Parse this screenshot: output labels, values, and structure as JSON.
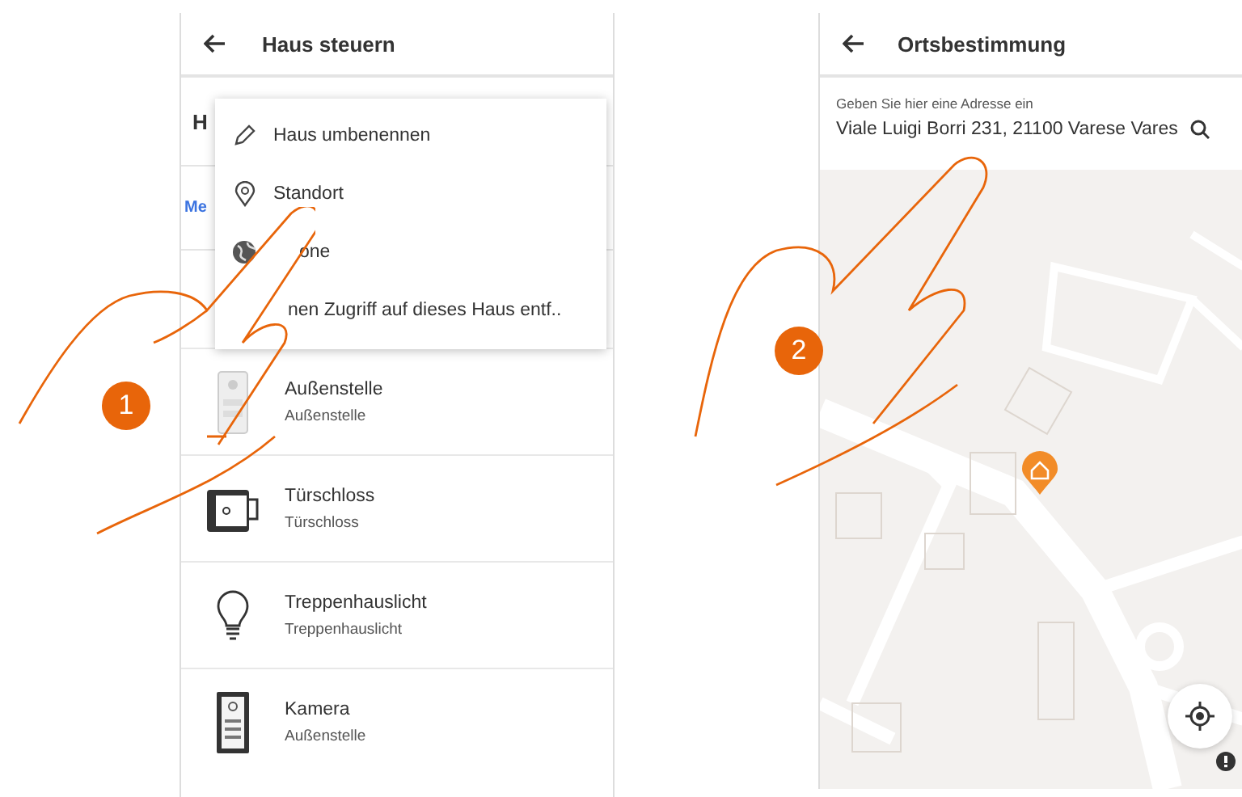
{
  "left_screen": {
    "title": "Haus steuern",
    "partial_row_text": "H",
    "partial_link": "Me",
    "menu": [
      {
        "kind": "rename",
        "label": "Haus umbenennen"
      },
      {
        "kind": "location",
        "label": "Standort"
      },
      {
        "kind": "zone",
        "label": "one"
      },
      {
        "kind": "plain",
        "label": "nen Zugriff auf dieses Haus entf.."
      }
    ],
    "devices": [
      {
        "kind": "outdoor",
        "name": "Außenstelle",
        "subtitle": "Außenstelle"
      },
      {
        "kind": "lock",
        "name": "Türschloss",
        "subtitle": "Türschloss"
      },
      {
        "kind": "light",
        "name": "Treppenhauslicht",
        "subtitle": "Treppenhauslicht"
      },
      {
        "kind": "camera",
        "name": "Kamera",
        "subtitle": "Außenstelle"
      }
    ]
  },
  "right_screen": {
    "title": "Ortsbestimmung",
    "address_field": {
      "label": "Geben Sie hier eine Adresse ein",
      "value": "Viale Luigi Borri 231, 21100 Varese Vares"
    }
  },
  "steps": [
    {
      "number": "1"
    },
    {
      "number": "2"
    }
  ]
}
